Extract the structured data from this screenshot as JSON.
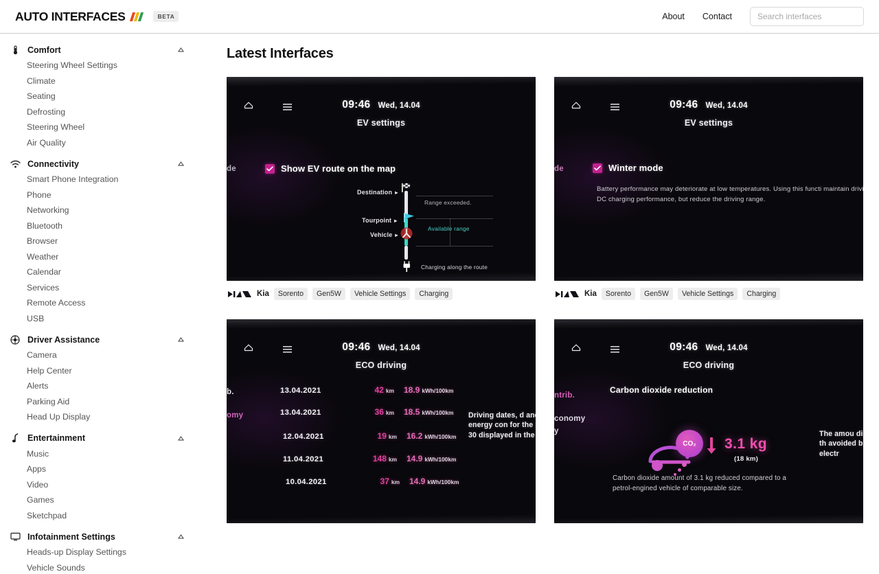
{
  "header": {
    "brand_text": "AUTO INTERFACES",
    "brand_bar_colors": [
      "#e8491f",
      "#f2b705",
      "#2e9e4f"
    ],
    "beta_label": "BETA",
    "nav": [
      {
        "label": "About",
        "name": "nav-link-about"
      },
      {
        "label": "Contact",
        "name": "nav-link-contact"
      }
    ],
    "search_placeholder": "Search interfaces",
    "search_value": ""
  },
  "sidebar": {
    "groups": [
      {
        "title": "Comfort",
        "icon": "thermometer-icon",
        "expanded": true,
        "items": [
          "Steering Wheel Settings",
          "Climate",
          "Seating",
          "Defrosting",
          "Steering Wheel",
          "Air Quality"
        ]
      },
      {
        "title": "Connectivity",
        "icon": "wifi-icon",
        "expanded": true,
        "items": [
          "Smart Phone Integration",
          "Phone",
          "Networking",
          "Bluetooth",
          "Browser",
          "Weather",
          "Calendar",
          "Services",
          "Remote Access",
          "USB"
        ]
      },
      {
        "title": "Driver Assistance",
        "icon": "steering-wheel-icon",
        "expanded": true,
        "items": [
          "Camera",
          "Help Center",
          "Alerts",
          "Parking Aid",
          "Head Up Display"
        ]
      },
      {
        "title": "Entertainment",
        "icon": "music-note-icon",
        "expanded": true,
        "items": [
          "Music",
          "Apps",
          "Video",
          "Games",
          "Sketchpad"
        ]
      },
      {
        "title": "Infotainment Settings",
        "icon": "monitor-icon",
        "expanded": true,
        "items": [
          "Heads-up Display Settings",
          "Vehicle Sounds"
        ]
      }
    ]
  },
  "main": {
    "page_title": "Latest Interfaces",
    "cards": [
      {
        "name": "card-ev-settings-route",
        "status_time": "09:46",
        "status_date": "Wed, 14.04",
        "screen_title": "EV settings",
        "left_fragment": "de",
        "checkbox_label": "Show EV route on the map",
        "checkbox_checked": true,
        "route_labels": [
          "Destination",
          "Tourpoint",
          "Vehicle"
        ],
        "route_notes": [
          "Range exceeded.",
          "Available range",
          "Charging along the route"
        ],
        "brand": "Kia",
        "tags": [
          "Sorento",
          "Gen5W",
          "Vehicle Settings",
          "Charging"
        ]
      },
      {
        "name": "card-ev-settings-winter",
        "status_time": "09:46",
        "status_date": "Wed, 14.04",
        "screen_title": "EV settings",
        "left_fragment": "de",
        "checkbox_label": "Winter mode",
        "checkbox_checked": true,
        "body_text": "Battery performance may deteriorate at low temperatures. Using this functi maintain driving and DC charging performance, but reduce the driving range.",
        "brand": "Kia",
        "tags": [
          "Sorento",
          "Gen5W",
          "Vehicle Settings",
          "Charging"
        ]
      },
      {
        "name": "card-eco-driving-table",
        "status_time": "09:46",
        "status_date": "Wed, 14.04",
        "screen_title": "ECO driving",
        "left_fragments": [
          "b.",
          "omy"
        ],
        "table": {
          "rows": [
            {
              "date": "13.04.2021",
              "distance": "42",
              "distance_unit": "km",
              "consumption": "18.9",
              "consumption_unit": "kWh/100km"
            },
            {
              "date": "13.04.2021",
              "distance": "36",
              "distance_unit": "km",
              "consumption": "18.5",
              "consumption_unit": "kWh/100km"
            },
            {
              "date": "12.04.2021",
              "distance": "19",
              "distance_unit": "km",
              "consumption": "16.2",
              "consumption_unit": "kWh/100km"
            },
            {
              "date": "11.04.2021",
              "distance": "148",
              "distance_unit": "km",
              "consumption": "14.9",
              "consumption_unit": "kWh/100km"
            },
            {
              "date": "10.04.2021",
              "distance": "37",
              "distance_unit": "km",
              "consumption": "14.9",
              "consumption_unit": "kWh/100km"
            }
          ]
        },
        "side_note": "Driving dates, d and energy con for the past 30 displayed in the"
      },
      {
        "name": "card-eco-driving-co2",
        "status_time": "09:46",
        "status_date": "Wed, 14.04",
        "screen_title": "ECO driving",
        "left_fragments": [
          "ntrib.",
          "conomy",
          "y"
        ],
        "co2_heading": "Carbon dioxide reduction",
        "co2_badge": "CO₂",
        "co2_value": "3.1 kg",
        "co2_sub": "(18 km)",
        "co2_caption": "Carbon dioxide amount of 3.1 kg reduced compared to a petrol-engined vehicle of comparable size.",
        "side_note": "The amou dioxide, th avoided b electr"
      }
    ]
  }
}
